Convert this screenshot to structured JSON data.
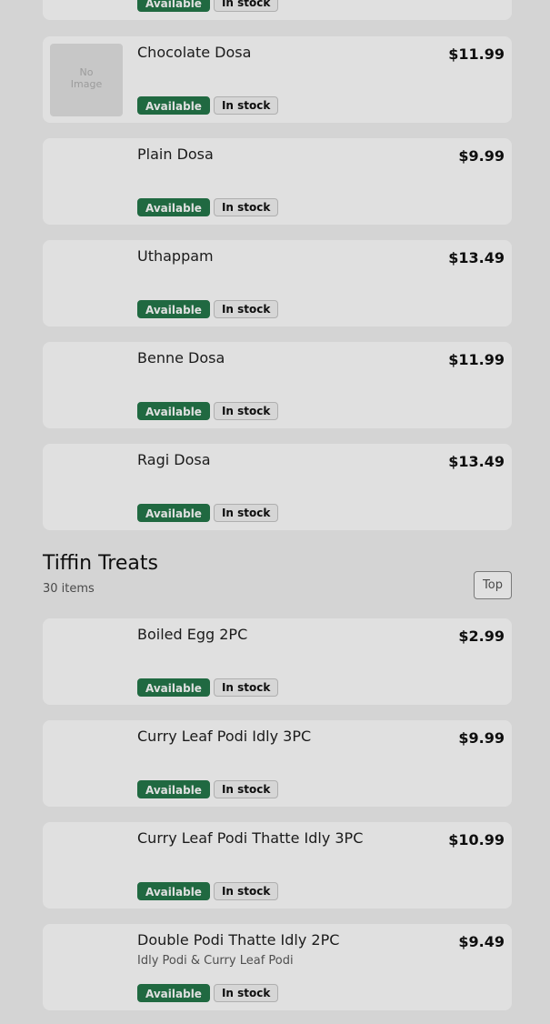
{
  "top_partial_item": {
    "badges": {
      "available": "Available",
      "stock": "In stock"
    }
  },
  "dosa_items": [
    {
      "name": "Chocolate Dosa",
      "price": "$11.99",
      "placeholder": "No Image",
      "available": "Available",
      "stock": "In stock"
    },
    {
      "name": "Plain Dosa",
      "price": "$9.99",
      "available": "Available",
      "stock": "In stock"
    },
    {
      "name": "Uthappam",
      "price": "$13.49",
      "available": "Available",
      "stock": "In stock"
    },
    {
      "name": "Benne Dosa",
      "price": "$11.99",
      "available": "Available",
      "stock": "In stock"
    },
    {
      "name": "Ragi Dosa",
      "price": "$13.49",
      "available": "Available",
      "stock": "In stock"
    }
  ],
  "section": {
    "title": "Tiffin Treats",
    "count": "30 items",
    "top_button": "Top"
  },
  "tiffin_items": [
    {
      "name": "Boiled Egg 2PC",
      "price": "$2.99",
      "available": "Available",
      "stock": "In stock"
    },
    {
      "name": "Curry Leaf Podi Idly 3PC",
      "price": "$9.99",
      "available": "Available",
      "stock": "In stock"
    },
    {
      "name": "Curry Leaf Podi Thatte Idly 3PC",
      "price": "$10.99",
      "available": "Available",
      "stock": "In stock"
    },
    {
      "name": "Double Podi Thatte Idly 2PC",
      "description": "Idly Podi & Curry Leaf Podi",
      "price": "$9.49",
      "available": "Available",
      "stock": "In stock"
    }
  ],
  "colors": {
    "available_badge": "#25784a",
    "card": "#ffffff",
    "background": "#f2f2f2"
  }
}
